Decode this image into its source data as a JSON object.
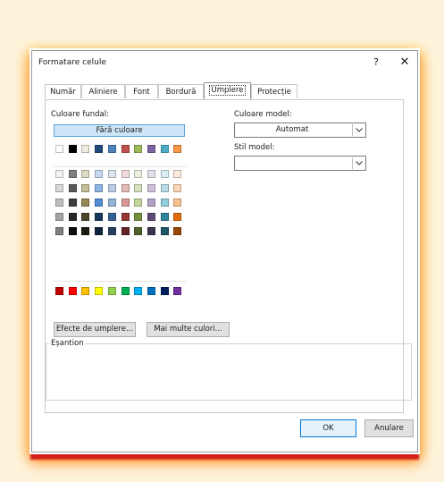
{
  "dialog": {
    "title": "Formatare celule",
    "help_label": "?",
    "close_label": "✕"
  },
  "tabs": [
    {
      "label": "Număr"
    },
    {
      "label": "Aliniere"
    },
    {
      "label": "Font"
    },
    {
      "label": "Bordură"
    },
    {
      "label": "Umplere"
    },
    {
      "label": "Protecție"
    }
  ],
  "fill": {
    "background_color_label": "Culoare fundal:",
    "no_color_label": "Fără culoare",
    "fill_effects_label": "Efecte de umplere...",
    "more_colors_label": "Mai multe culori...",
    "palette_top": [
      "#ffffff",
      "#000000",
      "#eeece1",
      "#1f497d",
      "#4f81bd",
      "#c0504d",
      "#9bbb59",
      "#8064a2",
      "#4bacc6",
      "#f79646"
    ],
    "palette_shades": [
      [
        "#f2f2f2",
        "#7f7f7f",
        "#ddd9c3",
        "#c6d9f0",
        "#dbe5f1",
        "#f2dcdb",
        "#ebf1dd",
        "#e5e0ec",
        "#dbeef3",
        "#fdeada"
      ],
      [
        "#d8d8d8",
        "#595959",
        "#c4bd97",
        "#8db3e2",
        "#b8cce4",
        "#e5b9b7",
        "#d7e3bc",
        "#ccc1d9",
        "#b7dde8",
        "#fbd5b5"
      ],
      [
        "#bfbfbf",
        "#3f3f3f",
        "#938953",
        "#548dd4",
        "#95b3d7",
        "#d99694",
        "#c3d69b",
        "#b2a2c7",
        "#92cddc",
        "#fac08f"
      ],
      [
        "#a5a5a5",
        "#262626",
        "#494429",
        "#17365d",
        "#366092",
        "#953734",
        "#76923c",
        "#5f497a",
        "#31859b",
        "#e36c09"
      ],
      [
        "#7f7f7f",
        "#0c0c0c",
        "#1d1b10",
        "#0f243e",
        "#244061",
        "#632423",
        "#4f6128",
        "#3f3151",
        "#205867",
        "#974806"
      ]
    ],
    "palette_standard": [
      "#c00000",
      "#ff0000",
      "#ffc000",
      "#ffff00",
      "#92d050",
      "#00b050",
      "#00b0f0",
      "#0070c0",
      "#002060",
      "#7030a0"
    ]
  },
  "pattern": {
    "color_label": "Culoare model:",
    "color_value": "Automat",
    "style_label": "Stil model:",
    "style_value": ""
  },
  "sample": {
    "label": "Eșantion"
  },
  "footer": {
    "ok_label": "OK",
    "cancel_label": "Anulare"
  }
}
